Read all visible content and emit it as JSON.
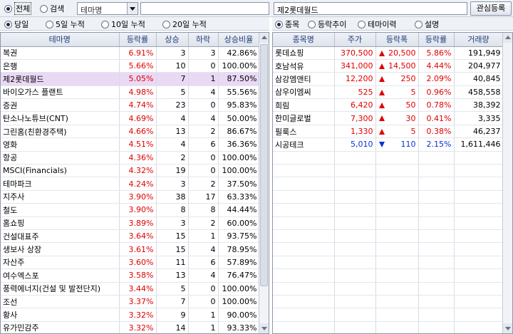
{
  "toolbar": {
    "radio_all": "전체",
    "radio_search": "검색",
    "combo_value": "테마명",
    "selected_theme": "제2롯데월드",
    "interest_button": "관심등록"
  },
  "period_filters": [
    "당일",
    "5일 누적",
    "10일 누적",
    "20일 누적"
  ],
  "right_view_options": [
    "종목",
    "등락추이",
    "테마이력",
    "설명"
  ],
  "left_table": {
    "headers": [
      "테마명",
      "등락률",
      "상승",
      "하락",
      "상승비율"
    ],
    "rows": [
      {
        "name": "복권",
        "rate": "6.91%",
        "up": "3",
        "down": "3",
        "ratio": "42.86%"
      },
      {
        "name": "은행",
        "rate": "5.66%",
        "up": "10",
        "down": "0",
        "ratio": "100.00%"
      },
      {
        "name": "제2롯데월드",
        "rate": "5.05%",
        "up": "7",
        "down": "1",
        "ratio": "87.50%"
      },
      {
        "name": "바이오가스 플랜트",
        "rate": "4.98%",
        "up": "5",
        "down": "4",
        "ratio": "55.56%"
      },
      {
        "name": "증권",
        "rate": "4.74%",
        "up": "23",
        "down": "0",
        "ratio": "95.83%"
      },
      {
        "name": "탄소나노튜브(CNT)",
        "rate": "4.69%",
        "up": "4",
        "down": "4",
        "ratio": "50.00%"
      },
      {
        "name": "그린홈(친환경주택)",
        "rate": "4.66%",
        "up": "13",
        "down": "2",
        "ratio": "86.67%"
      },
      {
        "name": "영화",
        "rate": "4.51%",
        "up": "4",
        "down": "6",
        "ratio": "36.36%"
      },
      {
        "name": "항공",
        "rate": "4.36%",
        "up": "2",
        "down": "0",
        "ratio": "100.00%"
      },
      {
        "name": "MSCI(Financials)",
        "rate": "4.32%",
        "up": "19",
        "down": "0",
        "ratio": "100.00%"
      },
      {
        "name": "테마파크",
        "rate": "4.24%",
        "up": "3",
        "down": "2",
        "ratio": "37.50%"
      },
      {
        "name": "지주사",
        "rate": "3.90%",
        "up": "38",
        "down": "17",
        "ratio": "63.33%"
      },
      {
        "name": "철도",
        "rate": "3.90%",
        "up": "8",
        "down": "8",
        "ratio": "44.44%"
      },
      {
        "name": "홈쇼핑",
        "rate": "3.89%",
        "up": "3",
        "down": "2",
        "ratio": "60.00%"
      },
      {
        "name": "건설대표주",
        "rate": "3.64%",
        "up": "15",
        "down": "1",
        "ratio": "93.75%"
      },
      {
        "name": "생보사 상장",
        "rate": "3.61%",
        "up": "15",
        "down": "4",
        "ratio": "78.95%"
      },
      {
        "name": "자산주",
        "rate": "3.60%",
        "up": "11",
        "down": "6",
        "ratio": "57.89%"
      },
      {
        "name": "여수엑스포",
        "rate": "3.58%",
        "up": "13",
        "down": "4",
        "ratio": "76.47%"
      },
      {
        "name": "풍력에너지(건설 및 발전단지)",
        "rate": "3.44%",
        "up": "5",
        "down": "0",
        "ratio": "100.00%"
      },
      {
        "name": "조선",
        "rate": "3.37%",
        "up": "7",
        "down": "0",
        "ratio": "100.00%"
      },
      {
        "name": "황사",
        "rate": "3.32%",
        "up": "9",
        "down": "1",
        "ratio": "90.00%"
      },
      {
        "name": "유가민감주",
        "rate": "3.32%",
        "up": "14",
        "down": "1",
        "ratio": "93.33%"
      }
    ]
  },
  "right_table": {
    "headers": [
      "종목명",
      "주가",
      "등락폭",
      "등락률",
      "거래량"
    ],
    "rows": [
      {
        "name": "롯데쇼핑",
        "price": "370,500",
        "dir": "up",
        "change": "20,500",
        "rate": "5.86%",
        "volume": "191,949"
      },
      {
        "name": "호남석유",
        "price": "341,000",
        "dir": "up",
        "change": "14,500",
        "rate": "4.44%",
        "volume": "204,977"
      },
      {
        "name": "삼강엠앤티",
        "price": "12,200",
        "dir": "up",
        "change": "250",
        "rate": "2.09%",
        "volume": "40,845"
      },
      {
        "name": "삼우이엠씨",
        "price": "525",
        "dir": "up",
        "change": "5",
        "rate": "0.96%",
        "volume": "458,558"
      },
      {
        "name": "희림",
        "price": "6,420",
        "dir": "up",
        "change": "50",
        "rate": "0.78%",
        "volume": "38,392"
      },
      {
        "name": "한미글로벌",
        "price": "7,300",
        "dir": "up",
        "change": "30",
        "rate": "0.41%",
        "volume": "3,335"
      },
      {
        "name": "필룩스",
        "price": "1,330",
        "dir": "up",
        "change": "5",
        "rate": "0.38%",
        "volume": "46,237"
      },
      {
        "name": "시공테크",
        "price": "5,010",
        "dir": "down",
        "change": "110",
        "rate": "2.15%",
        "volume": "1,611,446"
      }
    ]
  },
  "colors": {
    "up": "#e00000",
    "down": "#0b2fd6",
    "selected_row": "#ead9f5",
    "header": "#1f3a7a"
  }
}
